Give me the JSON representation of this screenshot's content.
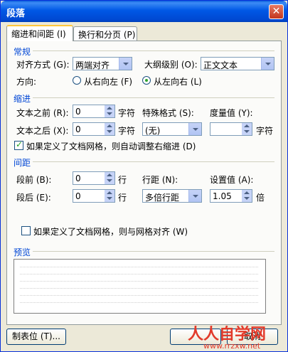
{
  "window": {
    "title": "段落"
  },
  "tabs": [
    {
      "label": "缩进和间距 (I)"
    },
    {
      "label": "换行和分页 (P)"
    }
  ],
  "general": {
    "heading": "常规",
    "alignment_label": "对齐方式 (G):",
    "alignment_value": "两端对齐",
    "outline_label": "大纲级别 (O):",
    "outline_value": "正文文本",
    "direction_label": "方向:",
    "rtl_label": "从右向左 (F)",
    "ltr_label": "从左向右 (L)"
  },
  "indent": {
    "heading": "缩进",
    "before_label": "文本之前 (R):",
    "before_value": "0",
    "before_unit": "字符",
    "after_label": "文本之后 (X):",
    "after_value": "0",
    "after_unit": "字符",
    "special_label": "特殊格式 (S):",
    "special_value": "(无)",
    "measure_label": "度量值 (Y):",
    "measure_value": "",
    "measure_unit": "字符",
    "grid_checkbox_label": "如果定义了文档网格，则自动调整右缩进 (D)"
  },
  "spacing": {
    "heading": "间距",
    "before_label": "段前 (B):",
    "before_value": "0",
    "before_unit": "行",
    "after_label": "段后 (E):",
    "after_value": "0",
    "after_unit": "行",
    "line_label": "行距 (N):",
    "line_value": "多倍行距",
    "set_label": "设置值 (A):",
    "set_value": "1.05",
    "set_unit": "倍",
    "grid_checkbox_label": "如果定义了文档网格，则与网格对齐 (W)"
  },
  "preview": {
    "heading": "预览"
  },
  "buttons": {
    "tabs": "制表位 (T)...",
    "ok": "",
    "cancel": "取消"
  },
  "watermark": {
    "text": "人人自学网",
    "url": "www.rrzxw.net"
  }
}
